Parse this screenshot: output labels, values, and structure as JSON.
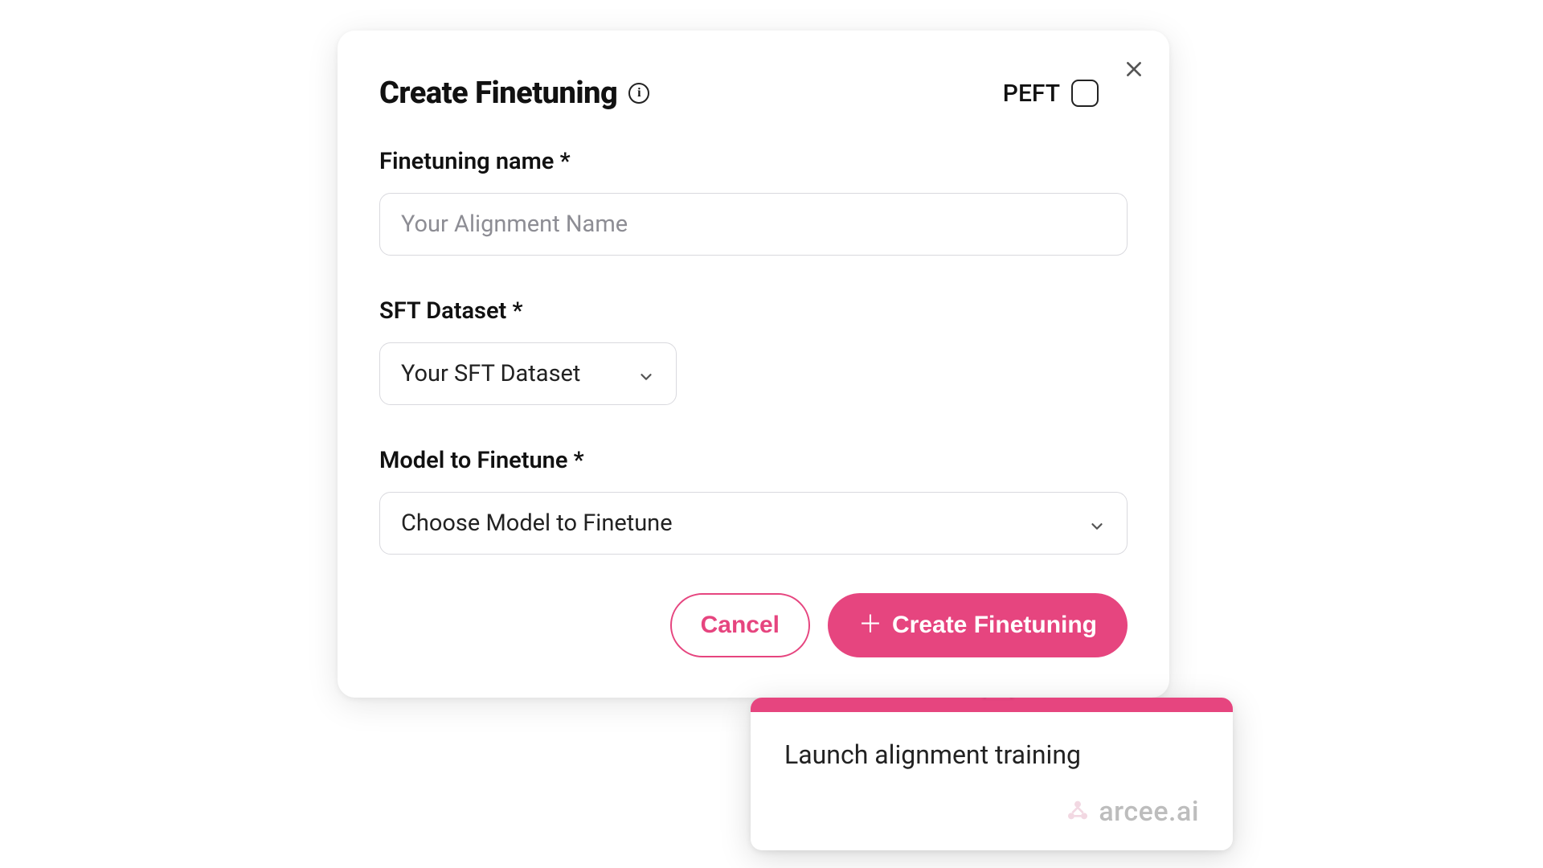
{
  "modal": {
    "title": "Create Finetuning",
    "peft_label": "PEFT",
    "peft_checked": false,
    "fields": {
      "name_label": "Finetuning name *",
      "name_placeholder": "Your Alignment Name",
      "dataset_label": "SFT Dataset *",
      "dataset_value": "Your SFT Dataset",
      "model_label": "Model to Finetune *",
      "model_value": "Choose Model to Finetune"
    },
    "actions": {
      "cancel": "Cancel",
      "create": "Create Finetuning"
    }
  },
  "tooltip": {
    "text": "Launch alignment training",
    "brand": "arcee.ai"
  },
  "colors": {
    "accent": "#e6457f"
  }
}
